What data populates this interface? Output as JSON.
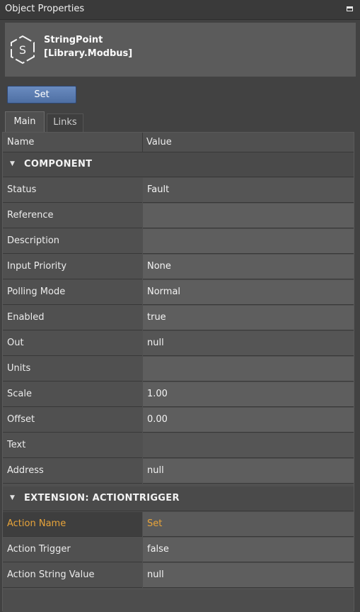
{
  "window": {
    "title": "Object Properties"
  },
  "object": {
    "name": "StringPoint",
    "library": "[Library.Modbus]",
    "icon": "string-point-hex-icon"
  },
  "toolbar": {
    "set_label": "Set"
  },
  "tabs": [
    {
      "label": "Main",
      "active": true
    },
    {
      "label": "Links",
      "active": false
    }
  ],
  "grid": {
    "name_header": "Name",
    "value_header": "Value"
  },
  "sections": {
    "component": "COMPONENT",
    "extension": "EXTENSION: ACTIONTRIGGER"
  },
  "component_rows": [
    {
      "name": "Status",
      "value": "Fault"
    },
    {
      "name": "Reference",
      "value": ""
    },
    {
      "name": "Description",
      "value": ""
    },
    {
      "name": "Input Priority",
      "value": "None"
    },
    {
      "name": "Polling Mode",
      "value": "Normal"
    },
    {
      "name": "Enabled",
      "value": "true"
    },
    {
      "name": "Out",
      "value": "null"
    },
    {
      "name": "Units",
      "value": ""
    },
    {
      "name": "Scale",
      "value": "1.00"
    },
    {
      "name": "Offset",
      "value": "0.00"
    },
    {
      "name": "Text",
      "value": ""
    },
    {
      "name": "Address",
      "value": "null"
    }
  ],
  "extension_rows": [
    {
      "name": "Action Name",
      "value": "Set"
    },
    {
      "name": "Action Trigger",
      "value": "false"
    },
    {
      "name": "Action String Value",
      "value": "null"
    }
  ],
  "colors": {
    "highlight": "#e8a43a",
    "button": "#5a7db4"
  }
}
